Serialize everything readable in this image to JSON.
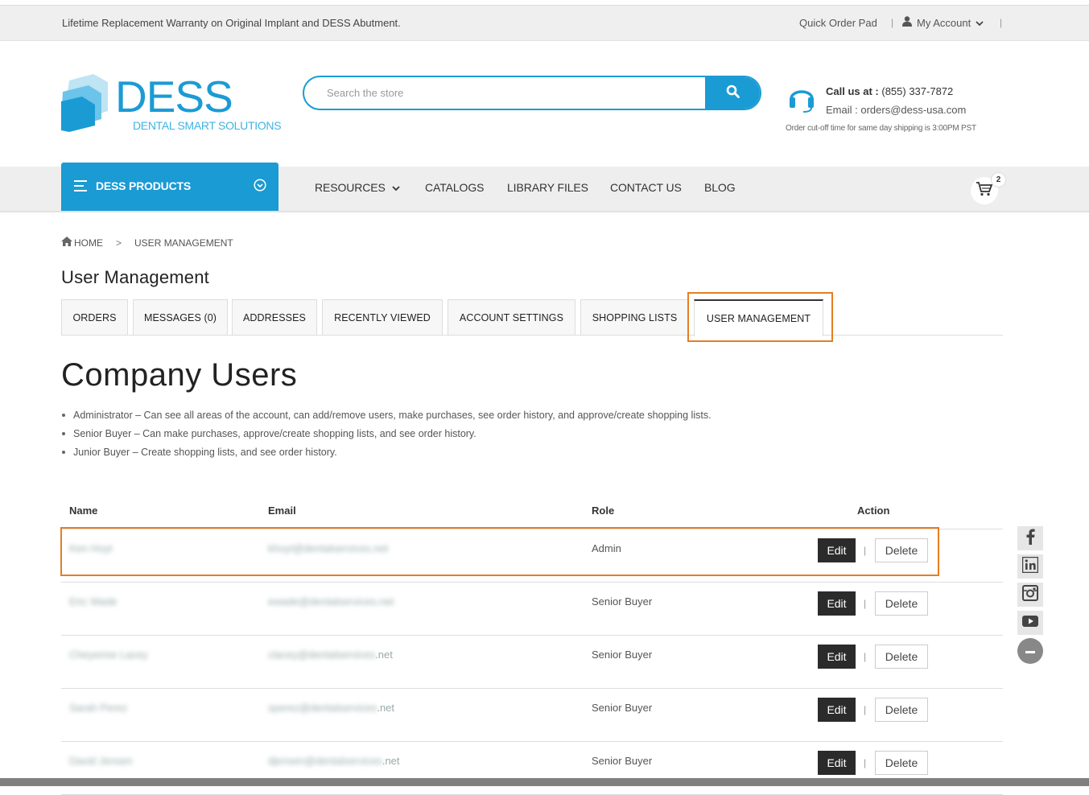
{
  "topbar": {
    "warranty": "Lifetime Replacement Warranty on Original Implant and DESS Abutment.",
    "quick_order": "Quick Order Pad",
    "account": "My Account",
    "separator": "|"
  },
  "header": {
    "logo_word": "DESS",
    "logo_sub": "DENTAL SMART SOLUTIONS",
    "search_placeholder": "Search the store",
    "call_label": "Call us at :",
    "call_number": " (855) 337-7872",
    "email": "Email : orders@dess-usa.com",
    "cutoff": "Order cut-off time for same day shipping is 3:00PM PST"
  },
  "nav": {
    "products": "DESS PRODUCTS",
    "resources": "RESOURCES",
    "catalogs": "CATALOGS",
    "library": "LIBRARY FILES",
    "contact": "CONTACT US",
    "blog": "BLOG",
    "cart_count": "2"
  },
  "breadcrumb": {
    "home": "HOME",
    "sep": ">",
    "current": "USER MANAGEMENT"
  },
  "page_title": "User Management",
  "tabs": [
    {
      "label": "ORDERS"
    },
    {
      "label": "MESSAGES (0)"
    },
    {
      "label": "ADDRESSES"
    },
    {
      "label": "RECENTLY VIEWED"
    },
    {
      "label": "ACCOUNT SETTINGS"
    },
    {
      "label": "SHOPPING LISTS"
    },
    {
      "label": "USER MANAGEMENT"
    }
  ],
  "company_title": "Company Users",
  "roles": [
    "Administrator – Can see all areas of the account, can add/remove users, make purchases, see order history, and approve/create shopping lists.",
    "Senior Buyer – Can make purchases, approve/create shopping lists, and see order history.",
    "Junior Buyer – Create shopping lists, and see order history."
  ],
  "table": {
    "headers": {
      "name": "Name",
      "email": "Email",
      "role": "Role",
      "action": "Action"
    },
    "edit_label": "Edit",
    "delete_label": "Delete",
    "pipe": "|",
    "rows": [
      {
        "name": "Ken Hoyt",
        "email_blur": "khoyt@dentalservices.net",
        "email_tail": "",
        "role": "Admin"
      },
      {
        "name": "Eric Wade",
        "email_blur": "ewade@dentalservices.net",
        "email_tail": "",
        "role": "Senior Buyer"
      },
      {
        "name": "Cheyenne Lacey",
        "email_blur": "clacey@dentalservices",
        "email_tail": ".net",
        "role": "Senior Buyer"
      },
      {
        "name": "Sarah Perez",
        "email_blur": "sperez@dentalservices",
        "email_tail": ".net",
        "role": "Senior Buyer"
      },
      {
        "name": "David Jensen",
        "email_blur": "djensen@dentalservices",
        "email_tail": ".net",
        "role": "Senior Buyer"
      }
    ]
  },
  "colors": {
    "brand": "#1b9bd4",
    "highlight": "#e57e22",
    "dark_button": "#2b2b2b"
  }
}
